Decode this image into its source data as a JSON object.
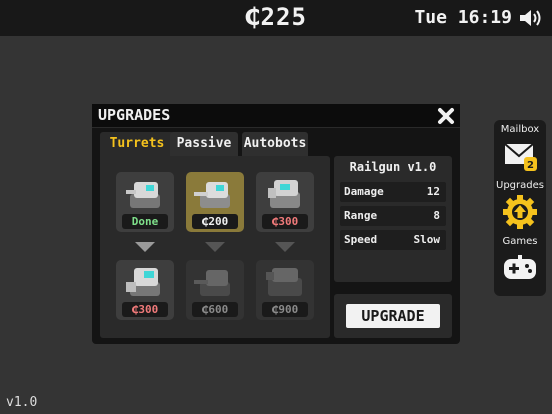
{
  "status_bar": {
    "credits": "₵225",
    "clock": "Tue 16:19",
    "icons": {
      "sound": "speaker-icon"
    }
  },
  "side_menu": {
    "items": [
      {
        "label": "Mailbox",
        "icon": "mail-icon",
        "badge": "2"
      },
      {
        "label": "Upgrades",
        "icon": "upgrade-gear-icon"
      },
      {
        "label": "Games",
        "icon": "gamepad-icon"
      }
    ]
  },
  "dialog": {
    "title": "UPGRADES",
    "tabs": [
      {
        "label": "Turrets",
        "active": true
      },
      {
        "label": "Passive",
        "active": false
      },
      {
        "label": "Autobots",
        "active": false
      }
    ],
    "turrets": [
      {
        "price": "Done",
        "state": "owned"
      },
      {
        "price": "₵200",
        "state": "selected"
      },
      {
        "price": "₵300",
        "state": "available"
      },
      {
        "price": "₵300",
        "state": "available"
      },
      {
        "price": "₵600",
        "state": "locked"
      },
      {
        "price": "₵900",
        "state": "locked"
      }
    ],
    "details": {
      "name": "Railgun v1.0",
      "stats": [
        {
          "label": "Damage",
          "value": "12"
        },
        {
          "label": "Range",
          "value": "8"
        },
        {
          "label": "Speed",
          "value": "Slow"
        }
      ],
      "upgrade_button": "UPGRADE"
    }
  },
  "version": "v1.0",
  "colors": {
    "accent": "#f5c21d",
    "done_text": "#7fe08a",
    "price_text": "#f0f0f0",
    "red_price": "#f07a7a",
    "locked_price": "#8a8a8a"
  }
}
